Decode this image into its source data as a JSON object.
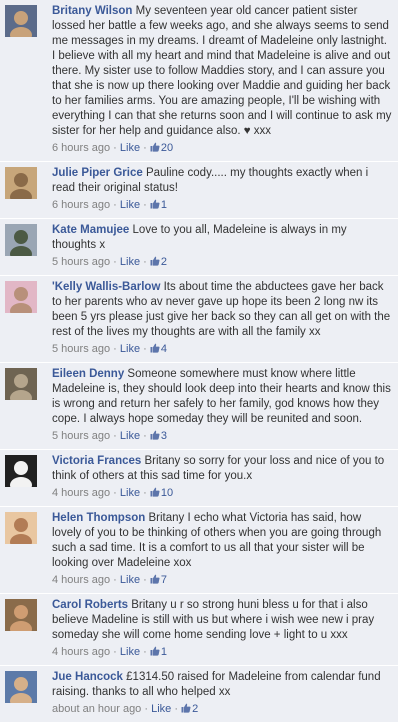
{
  "comments": [
    {
      "author": "Britany Wilson",
      "text": "My seventeen year old cancer patient sister lossed her battle a few weeks ago, and she always seems to send me messages in my dreams. I dreamt of Madeleine only lastnight. I believe with all my heart and mind that Madeleine is alive and out there. My sister use to follow Maddies story, and I can assure you that she is now up there looking over Maddie and guiding her back to her families arms. You are amazing people, I'll be wishing with everything I can that she returns soon and I will continue to ask my sister for her help and guidance also. ♥ xxx",
      "time": "6 hours ago",
      "like_label": "Like",
      "likes": "20",
      "avatar_colors": [
        "#5b6b8a",
        "#c8a27a"
      ]
    },
    {
      "author": "Julie Piper Grice",
      "text": "Pauline cody..... my thoughts exactly when i read their original status!",
      "time": "6 hours ago",
      "like_label": "Like",
      "likes": "1",
      "avatar_colors": [
        "#c7a67a",
        "#8a6a48"
      ]
    },
    {
      "author": "Kate Mamujee",
      "text": "Love to you all, Madeleine is always in my thoughts x",
      "time": "5 hours ago",
      "like_label": "Like",
      "likes": "2",
      "avatar_colors": [
        "#9aa6b4",
        "#4c5a44"
      ]
    },
    {
      "author": "'Kelly Wallis-Barlow",
      "text": "Its about time the abductees gave her back to her parents who av never gave up hope its been 2 long nw its been 5 yrs please just give her back so they can all get on with the rest of the lives my thoughts are with all the family xx",
      "time": "5 hours ago",
      "like_label": "Like",
      "likes": "4",
      "avatar_colors": [
        "#e2b7c6",
        "#b8907a"
      ]
    },
    {
      "author": "Eileen Denny",
      "text": "Someone somewhere must know where little Madeleine is, they should look deep into their hearts and know this is wrong and return her safely to her family, god knows how they cope. I always hope someday they will be reunited and soon.",
      "time": "5 hours ago",
      "like_label": "Like",
      "likes": "3",
      "avatar_colors": [
        "#6f6452",
        "#b5a58c"
      ]
    },
    {
      "author": "Victoria Frances",
      "text": "Britany so sorry for your loss and nice of you to think of others at this sad time for you.x",
      "time": "4 hours ago",
      "like_label": "Like",
      "likes": "10",
      "avatar_colors": [
        "#202020",
        "#f2f2f2"
      ]
    },
    {
      "author": "Helen Thompson",
      "text": "Britany I echo what Victoria has said, how lovely of you to be thinking of others when you are going through such a sad time. It is a comfort to us all that your sister will be looking over Madeleine xox",
      "time": "4 hours ago",
      "like_label": "Like",
      "likes": "7",
      "avatar_colors": [
        "#e9c7a1",
        "#b27c55"
      ]
    },
    {
      "author": "Carol Roberts",
      "text": "Britany u r so strong huni bless u for that i also believe Madeline is still with us but where i wish wee new i pray someday she will come home sending love + light to u xxx",
      "time": "4 hours ago",
      "like_label": "Like",
      "likes": "1",
      "avatar_colors": [
        "#8a6b4a",
        "#cf9d72"
      ]
    },
    {
      "author": "Jue Hancock",
      "text": "£1314.50 raised for Madeleine from calendar fund raising. thanks to all who helped xx",
      "time": "about an hour ago",
      "like_label": "Like",
      "likes": "2",
      "avatar_colors": [
        "#5c7aa8",
        "#d6b089"
      ]
    }
  ],
  "colors": {
    "background": "#edeff4",
    "link": "#3b5998",
    "muted": "#808080"
  }
}
